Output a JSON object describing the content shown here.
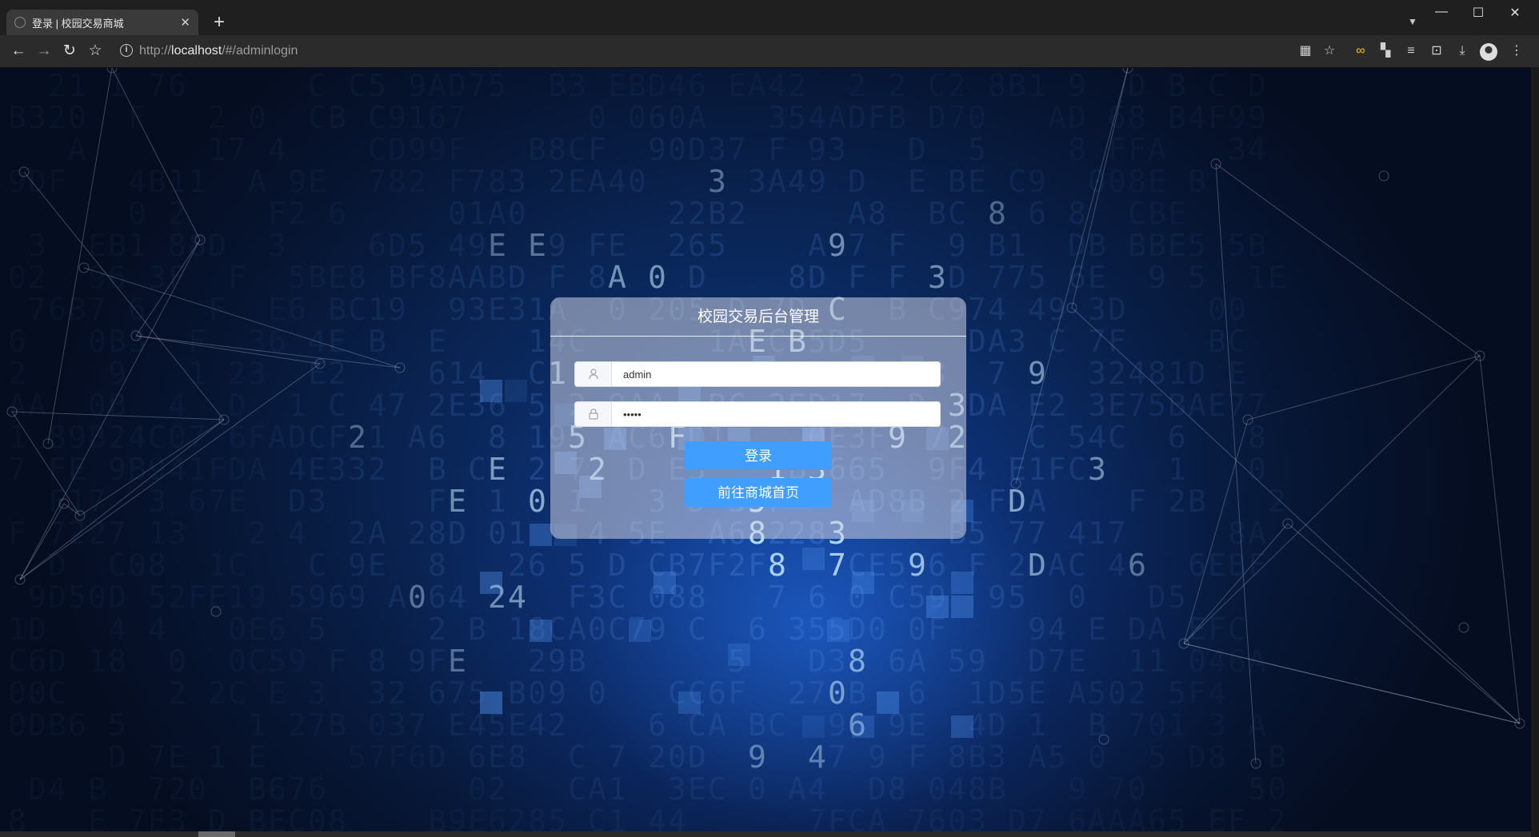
{
  "browser": {
    "tab_title": "登录 | 校园交易商城",
    "tab_close": "✕",
    "new_tab": "+",
    "url_prefix": "http://",
    "url_host": "localhost",
    "url_path": "/#/adminlogin"
  },
  "login": {
    "title": "校园交易后台管理",
    "username_value": "admin",
    "password_value": "admin",
    "login_button": "登录",
    "home_button": "前往商城首页"
  },
  "colors": {
    "primary_button": "#409eff",
    "panel": "rgba(205,210,226,0.55)"
  },
  "icons": [
    "back-icon",
    "forward-icon",
    "reload-icon",
    "bookmark-star-icon",
    "info-icon",
    "qr-icon",
    "star-icon",
    "extension-icon",
    "grid-icon",
    "playlist-icon",
    "crop-icon",
    "download-icon",
    "menu-icon",
    "user-icon",
    "lock-icon"
  ]
}
